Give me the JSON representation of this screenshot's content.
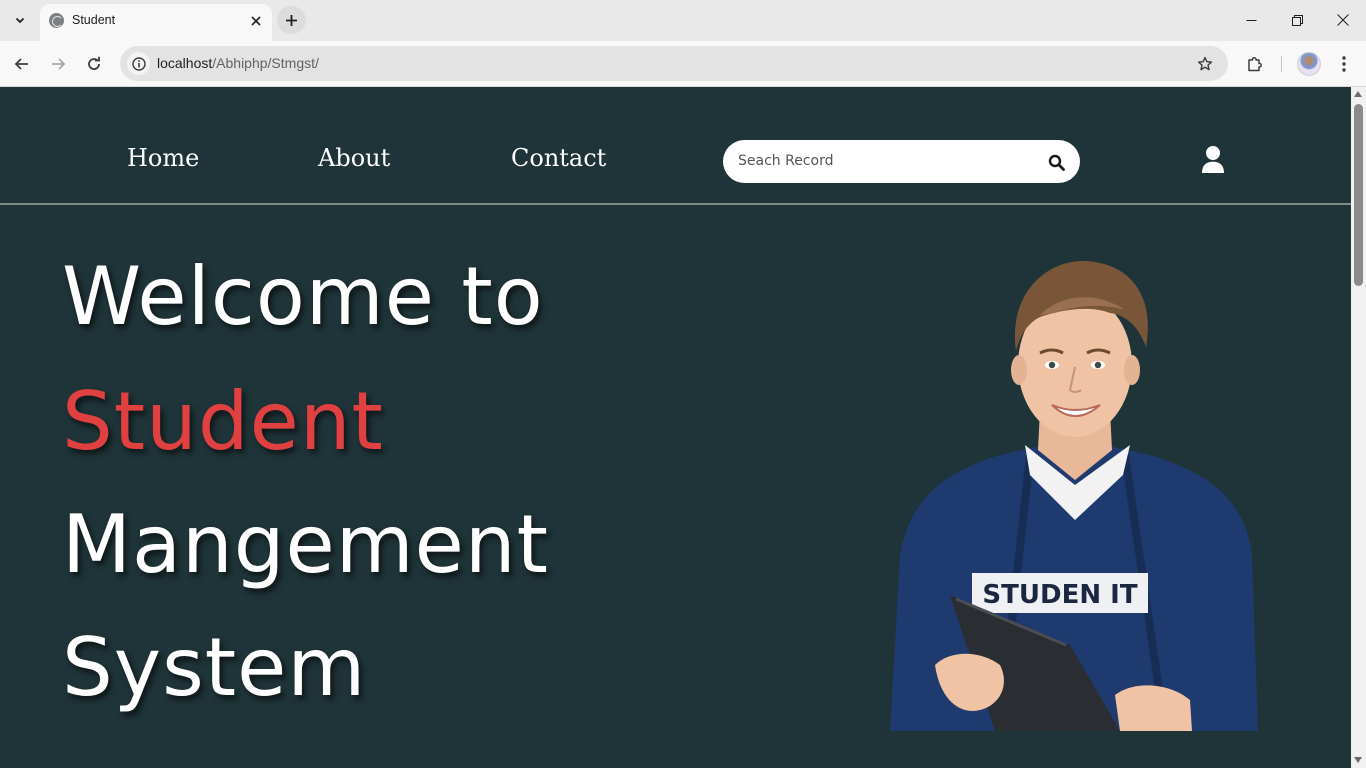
{
  "browser": {
    "tab_title": "Student",
    "url_host": "localhost",
    "url_path": "/Abhiphp/Stmgst/"
  },
  "nav": {
    "links": [
      "Home",
      "About",
      "Contact"
    ],
    "search_placeholder": "Seach Record"
  },
  "hero": {
    "line1": "Welcome to",
    "line2": "Student",
    "line3": "Mangement",
    "line4": "System"
  },
  "image": {
    "shirt_text": "STUDEN IT"
  },
  "colors": {
    "page_bg": "#1f3438",
    "accent": "#e04140",
    "text": "#ffffff",
    "sweater": "#1f3a6e"
  },
  "icons": [
    "tab-search-icon",
    "globe-icon",
    "close-icon",
    "plus-icon",
    "minimize-icon",
    "restore-icon",
    "back-icon",
    "forward-icon",
    "reload-icon",
    "info-icon",
    "star-icon",
    "extensions-icon",
    "more-icon",
    "search-icon",
    "user-icon"
  ]
}
